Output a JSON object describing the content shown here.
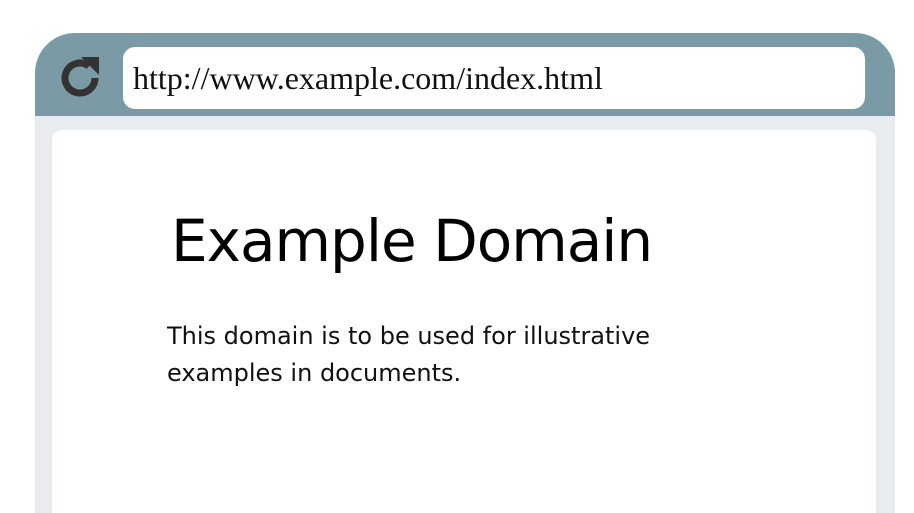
{
  "browser": {
    "address_bar": {
      "url": "http://www.example.com/index.html"
    },
    "toolbar": {
      "reload_icon": "reload-icon"
    }
  },
  "page": {
    "title": "Example Domain",
    "paragraph": "This domain is to be used for illustrative examples in documents."
  },
  "colors": {
    "toolbar": "#7a9ba6",
    "frame": "#e8ecf0",
    "content": "#ffffff",
    "icon": "#333333"
  }
}
